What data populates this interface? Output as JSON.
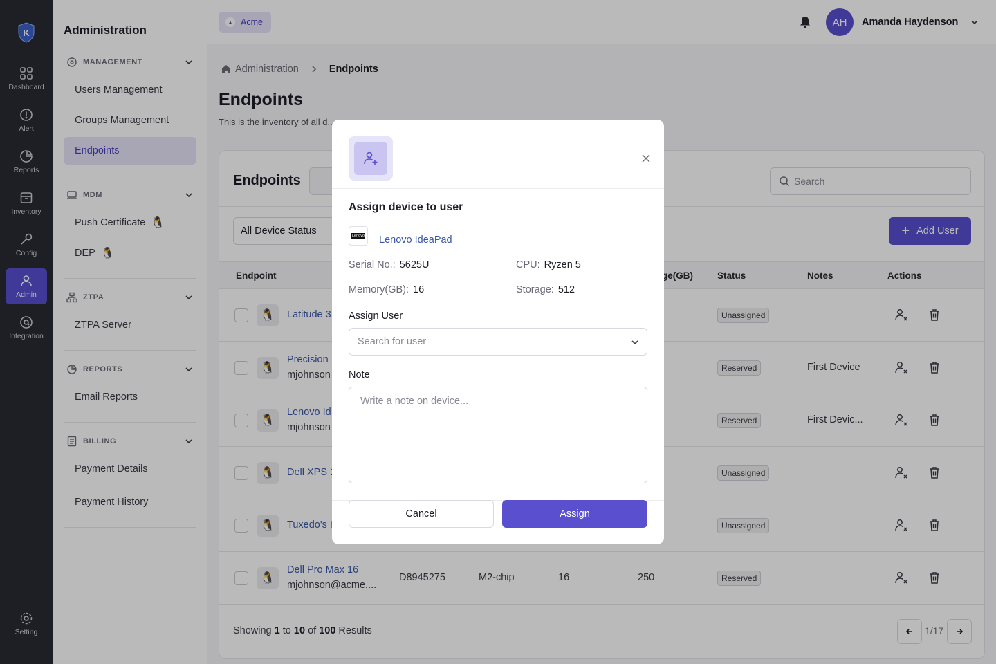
{
  "rail": {
    "items": [
      {
        "label": "Dashboard",
        "icon": "grid-icon"
      },
      {
        "label": "Alert",
        "icon": "alert-icon"
      },
      {
        "label": "Reports",
        "icon": "pie-chart-icon"
      },
      {
        "label": "Inventory",
        "icon": "archive-icon"
      },
      {
        "label": "Config",
        "icon": "wrench-icon"
      },
      {
        "label": "Admin",
        "icon": "user-icon",
        "active": true
      },
      {
        "label": "Integration",
        "icon": "integration-icon"
      }
    ],
    "setting_label": "Setting"
  },
  "sidebar": {
    "title": "Administration",
    "sections": [
      {
        "title": "MANAGEMENT",
        "items": [
          "Users Management",
          "Groups Management",
          "Endpoints"
        ]
      },
      {
        "title": "MDM",
        "items": [
          "Push Certificate",
          "DEP"
        ]
      },
      {
        "title": "ZTPA",
        "items": [
          "ZTPA Server"
        ]
      },
      {
        "title": "REPORTS",
        "items": [
          "Email Reports"
        ]
      },
      {
        "title": "BILLING",
        "items": [
          "Payment Details",
          "Payment History"
        ]
      }
    ]
  },
  "topbar": {
    "org": "Acme",
    "avatar_initials": "AH",
    "user_name": "Amanda Haydenson"
  },
  "breadcrumb": {
    "root": "Administration",
    "current": "Endpoints"
  },
  "page": {
    "title": "Endpoints",
    "subtitle": "This is the inventory of all d..."
  },
  "card": {
    "title": "Endpoints",
    "search_placeholder": "Search",
    "filter_label": "All Device Status",
    "add_button": "Add User",
    "columns": {
      "endpoint": "Endpoint",
      "storage": "ge(GB)",
      "status": "Status",
      "notes": "Notes",
      "actions": "Actions"
    },
    "rows": [
      {
        "name": "Latitude 3",
        "email": "",
        "serial": "",
        "cpu": "",
        "memory": "",
        "storage": "",
        "status": "Unassigned",
        "note": ""
      },
      {
        "name": "Precision",
        "email": "mjohnson",
        "serial": "",
        "cpu": "",
        "memory": "",
        "storage": "",
        "status": "Reserved",
        "note": "First Device"
      },
      {
        "name": "Lenovo Id",
        "email": "mjohnson",
        "serial": "",
        "cpu": "",
        "memory": "",
        "storage": "",
        "status": "Reserved",
        "note": "First Devic..."
      },
      {
        "name": "Dell XPS 1",
        "email": "",
        "serial": "",
        "cpu": "",
        "memory": "",
        "storage": "",
        "status": "Unassigned",
        "note": ""
      },
      {
        "name": "Tuxedo's I",
        "email": "",
        "serial": "",
        "cpu": "",
        "memory": "",
        "storage": "",
        "status": "Unassigned",
        "note": ""
      },
      {
        "name": "Dell Pro Max 16",
        "email": "mjohnson@acme....",
        "serial": "D8945275",
        "cpu": "M2-chip",
        "memory": "16",
        "storage": "250",
        "status": "Reserved",
        "note": ""
      }
    ],
    "footer": {
      "prefix": "Showing",
      "from": "1",
      "to_word": "to",
      "to": "10",
      "of_word": "of",
      "total": "100",
      "suffix": "Results"
    },
    "page_indicator": "1/17"
  },
  "modal": {
    "title": "Assign device to user",
    "brand": "Lenovo",
    "device_name": "Lenovo IdeaPad",
    "serial_label": "Serial No.:",
    "serial": "5625U",
    "cpu_label": "CPU:",
    "cpu": "Ryzen 5",
    "memory_label": "Memory(GB):",
    "memory": "16",
    "storage_label": "Storage:",
    "storage": "512",
    "assign_user_label": "Assign User",
    "user_placeholder": "Search for user",
    "note_label": "Note",
    "note_placeholder": "Write a note on device...",
    "cancel": "Cancel",
    "assign": "Assign"
  },
  "colors": {
    "accent": "#5a4fcf",
    "rail": "#2a2a33",
    "link": "#3b58a8"
  }
}
